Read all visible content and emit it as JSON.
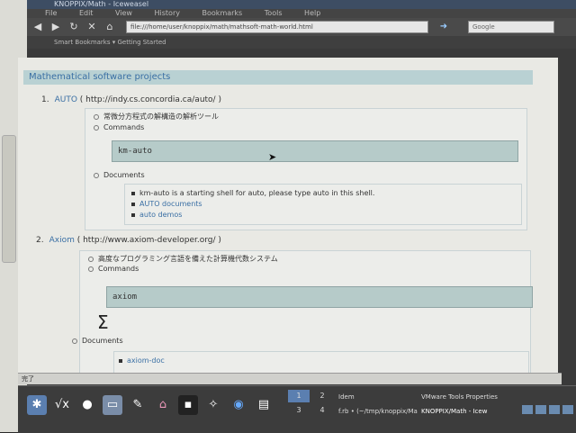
{
  "window": {
    "title": "KNOPPIX/Math - Iceweasel",
    "menu": [
      "File",
      "Edit",
      "View",
      "History",
      "Bookmarks",
      "Tools",
      "Help"
    ],
    "url": "file:///home/user/knoppix/math/mathsoft-math-world.html",
    "search_placeholder": "Google",
    "bookmarks_label": "Smart Bookmarks ▾  Getting Started"
  },
  "page": {
    "section_title": "Mathematical software projects",
    "items": [
      {
        "num": "1.",
        "name": "AUTO",
        "url": "( http://indy.cs.concordia.ca/auto/ )",
        "desc": "常微分方程式の解構造の解析ツール",
        "commands_label": "Commands",
        "command": "km-auto",
        "documents_label": "Documents",
        "documents": [
          "km-auto is a starting shell for auto, please type auto in this shell.",
          "AUTO documents",
          "auto demos"
        ]
      },
      {
        "num": "2.",
        "name": "Axiom",
        "url": "( http://www.axiom-developer.org/ )",
        "desc": "高度なプログラミング言語を備えた計算機代数システム",
        "commands_label": "Commands",
        "command": "axiom",
        "logo": "Σ",
        "documents_label": "Documents",
        "documents": [
          "axiom-doc"
        ]
      }
    ]
  },
  "status": "完了",
  "taskbar": {
    "desktops": [
      "1",
      "2",
      "3",
      "4"
    ],
    "tasks": [
      "Idem",
      "VMware Tools Properties",
      "f.rb • (~/tmp/knoppix/Ma",
      "KNOPPIX/Math - Icew"
    ]
  }
}
